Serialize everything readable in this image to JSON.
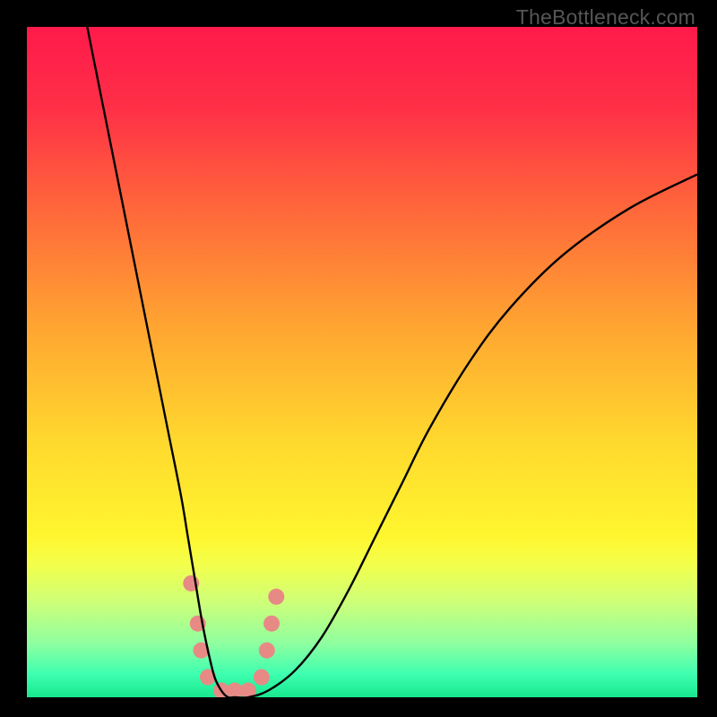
{
  "watermark": "TheBottleneck.com",
  "chart_data": {
    "type": "line",
    "title": "",
    "xlabel": "",
    "ylabel": "",
    "xlim": [
      0,
      100
    ],
    "ylim": [
      0,
      100
    ],
    "grid": false,
    "legend": false,
    "background_gradient": {
      "stops": [
        {
          "offset": 0.0,
          "color": "#ff1a4b"
        },
        {
          "offset": 0.12,
          "color": "#ff2f47"
        },
        {
          "offset": 0.28,
          "color": "#ff6a3a"
        },
        {
          "offset": 0.45,
          "color": "#ffa631"
        },
        {
          "offset": 0.62,
          "color": "#ffd92e"
        },
        {
          "offset": 0.76,
          "color": "#fff62f"
        },
        {
          "offset": 0.8,
          "color": "#f4ff4a"
        },
        {
          "offset": 0.86,
          "color": "#ccff7a"
        },
        {
          "offset": 0.92,
          "color": "#8effa0"
        },
        {
          "offset": 0.965,
          "color": "#3fffb0"
        },
        {
          "offset": 1.0,
          "color": "#17e88f"
        }
      ]
    },
    "series": [
      {
        "name": "bottleneck-curve",
        "color": "#000000",
        "x": [
          9,
          11,
          13,
          15,
          17,
          19,
          21,
          23,
          24,
          25,
          26,
          27,
          28,
          29,
          30,
          31,
          33,
          36,
          40,
          44,
          48,
          52,
          56,
          60,
          66,
          72,
          80,
          90,
          100
        ],
        "y": [
          100,
          90,
          80,
          70,
          60,
          50,
          40,
          30,
          24,
          18,
          12,
          7,
          3,
          1,
          0,
          0,
          0,
          1,
          4,
          9,
          16,
          24,
          32,
          40,
          50,
          58,
          66,
          73,
          78
        ]
      }
    ],
    "markers": {
      "name": "highlight-points",
      "color": "#e78a85",
      "radius_px": 9,
      "points": [
        {
          "x": 24.5,
          "y": 17
        },
        {
          "x": 25.5,
          "y": 11
        },
        {
          "x": 26.0,
          "y": 7
        },
        {
          "x": 27.0,
          "y": 3
        },
        {
          "x": 29.0,
          "y": 1
        },
        {
          "x": 31.0,
          "y": 1
        },
        {
          "x": 33.0,
          "y": 1
        },
        {
          "x": 35.0,
          "y": 3
        },
        {
          "x": 35.8,
          "y": 7
        },
        {
          "x": 36.5,
          "y": 11
        },
        {
          "x": 37.2,
          "y": 15
        }
      ]
    }
  }
}
